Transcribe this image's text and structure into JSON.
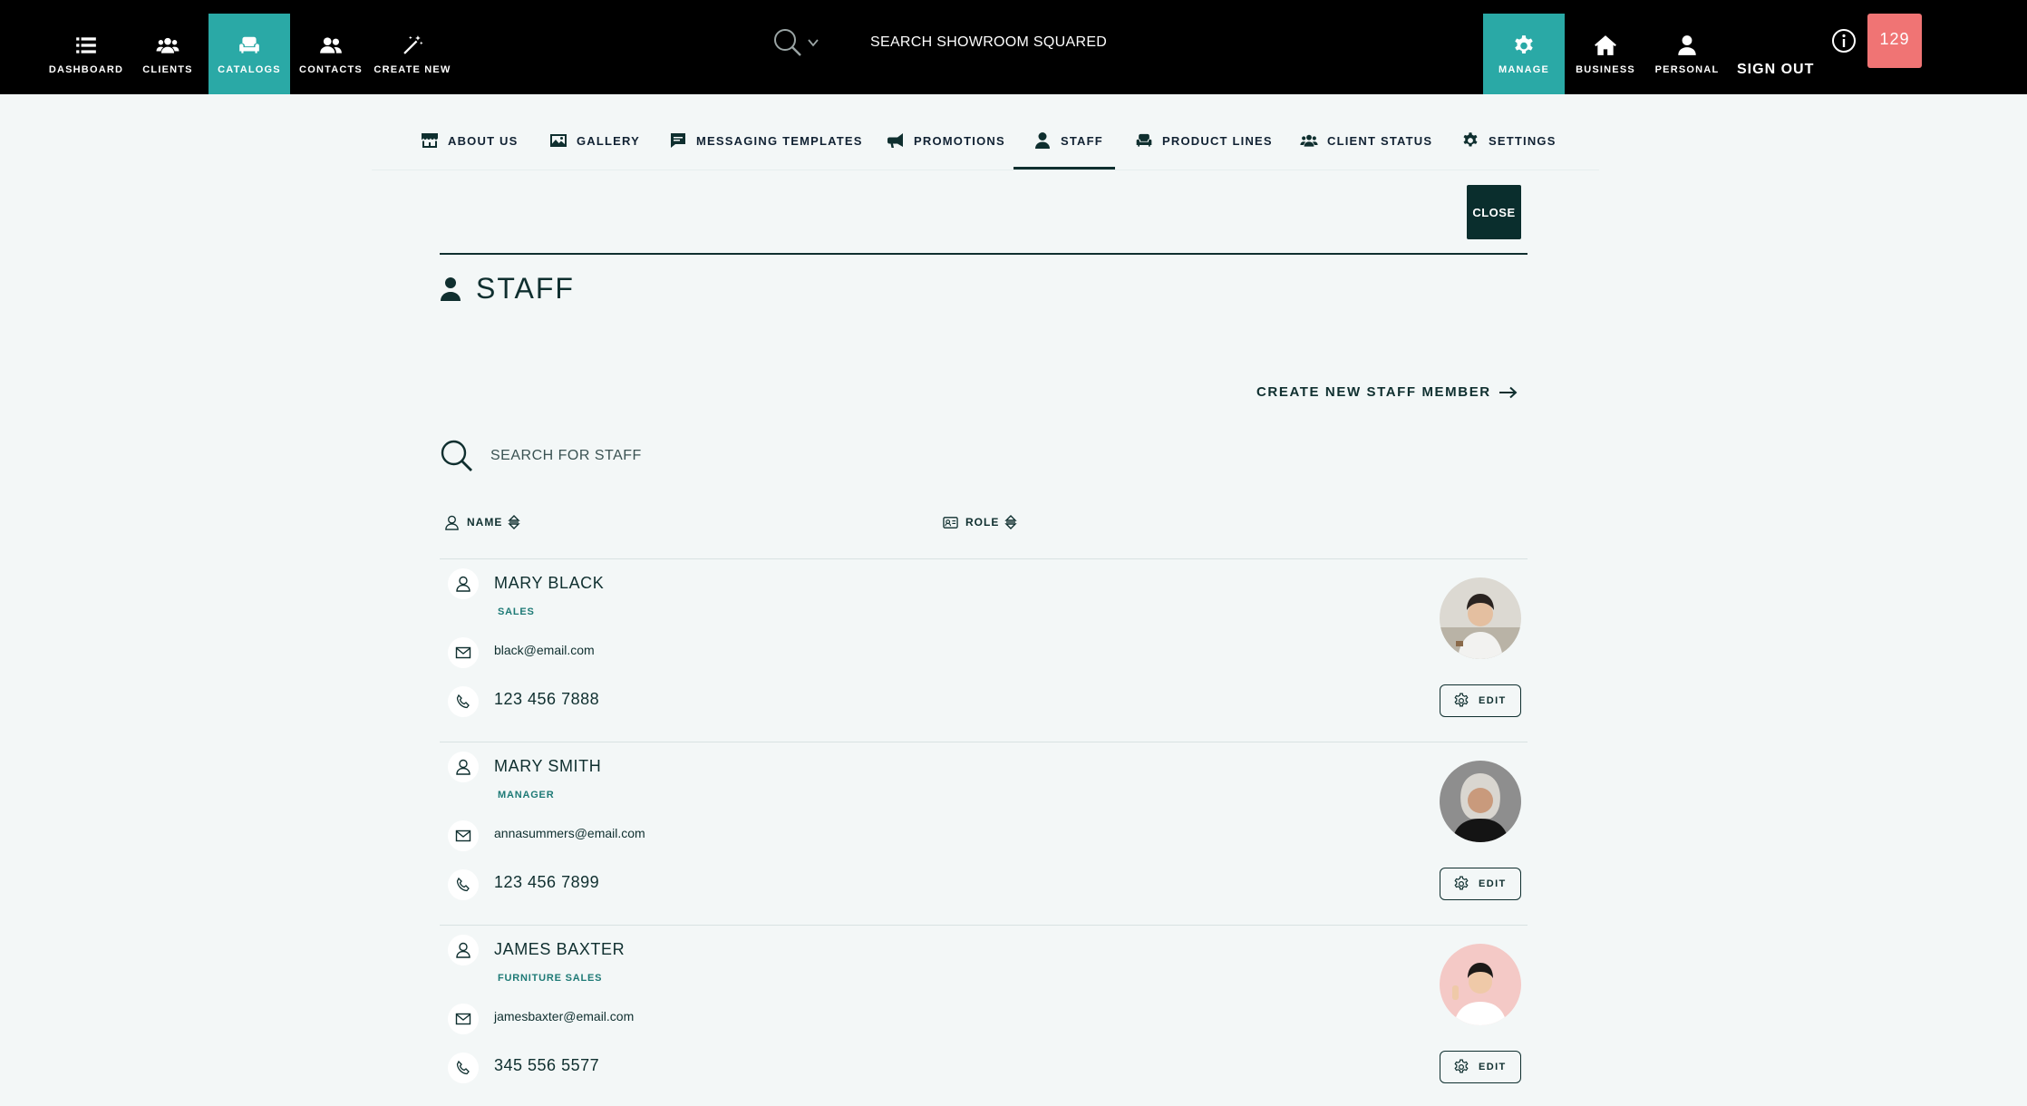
{
  "topnav": {
    "items": [
      {
        "label": "DASHBOARD",
        "icon": "list-icon"
      },
      {
        "label": "CLIENTS",
        "icon": "users-group-icon"
      },
      {
        "label": "CATALOGS",
        "icon": "sofa-icon",
        "active": true
      },
      {
        "label": "CONTACTS",
        "icon": "contacts-icon"
      },
      {
        "label": "CREATE NEW",
        "icon": "magic-wand-icon"
      }
    ],
    "search_label": "SEARCH SHOWROOM SQUARED",
    "right_items": [
      {
        "label": "MANAGE",
        "icon": "gear-icon",
        "active": true
      },
      {
        "label": "BUSINESS",
        "icon": "home-icon"
      },
      {
        "label": "PERSONAL",
        "icon": "user-icon"
      }
    ],
    "sign_out": "SIGN OUT",
    "counter": "129"
  },
  "subtabs": [
    {
      "label": "ABOUT US",
      "icon": "storefront-icon"
    },
    {
      "label": "GALLERY",
      "icon": "image-icon"
    },
    {
      "label": "MESSAGING TEMPLATES",
      "icon": "message-icon"
    },
    {
      "label": "PROMOTIONS",
      "icon": "megaphone-icon"
    },
    {
      "label": "STAFF",
      "icon": "user-icon",
      "active": true
    },
    {
      "label": "PRODUCT LINES",
      "icon": "sofa-icon"
    },
    {
      "label": "CLIENT STATUS",
      "icon": "users-group-icon"
    },
    {
      "label": "SETTINGS",
      "icon": "gear-icon"
    }
  ],
  "close_label": "CLOSE",
  "page_title": "STAFF",
  "create_label": "CREATE NEW STAFF MEMBER",
  "search_placeholder": "SEARCH FOR STAFF",
  "columns": {
    "name": "NAME",
    "role": "ROLE"
  },
  "staff": [
    {
      "name": "MARY BLACK",
      "role": "SALES",
      "email": "black@email.com",
      "phone": "123 456 7888",
      "edit": "EDIT"
    },
    {
      "name": "MARY SMITH",
      "role": "MANAGER",
      "email": "annasummers@email.com",
      "phone": "123 456 7899",
      "edit": "EDIT"
    },
    {
      "name": "JAMES BAXTER",
      "role": "FURNITURE SALES",
      "email": "jamesbaxter@email.com",
      "phone": "345 556 5577",
      "edit": "EDIT"
    }
  ],
  "colors": {
    "accent": "#2aa9a6",
    "dark": "#0f2f2f",
    "counter": "#f07474",
    "background": "#f3f7f7"
  }
}
